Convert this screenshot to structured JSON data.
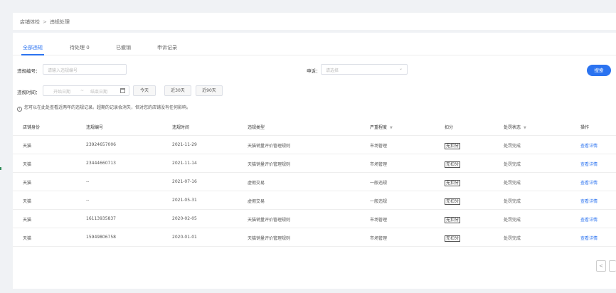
{
  "breadcrumb": {
    "root": "店铺体检",
    "separator": ">",
    "current": "违规处理"
  },
  "tabs": [
    {
      "label": "全部违规",
      "active": true
    },
    {
      "label": "待处理 0",
      "active": false
    },
    {
      "label": "已撤销",
      "active": false
    },
    {
      "label": "申诉记录",
      "active": false
    }
  ],
  "filters": {
    "violation_no_label": "违规编号：",
    "violation_no_placeholder": "请输入违规编号",
    "appeal_label": "申诉：",
    "appeal_placeholder": "请选择",
    "time_label": "违规时间：",
    "start_placeholder": "开始日期",
    "range_separator": "~",
    "end_placeholder": "结束日期",
    "quick_today": "今天",
    "quick_30": "近30天",
    "quick_90": "近90天",
    "search_button": "搜索"
  },
  "notice": "您可以在此处查看近两年的违规记录。超期的记录会消失，但对您的店铺没有任何影响。",
  "table": {
    "headers": [
      "店铺身份",
      "违规编号",
      "违规时间",
      "违规类型",
      "严重程度",
      "扣分",
      "处罚状态",
      "操作"
    ],
    "rows": [
      [
        "天猫",
        "23924657006",
        "2021-11-29",
        "天猫销量评价管理规则",
        "市场管理",
        "无扣分",
        "处罚完成",
        "查看详情"
      ],
      [
        "天猫",
        "23444660713",
        "2021-11-14",
        "天猫销量评价管理规则",
        "市场管理",
        "无扣分",
        "处罚完成",
        "查看详情"
      ],
      [
        "天猫",
        "--",
        "2021-07-16",
        "虚假交易",
        "一般违规",
        "无扣分",
        "处罚完成",
        "查看详情"
      ],
      [
        "天猫",
        "--",
        "2021-05-31",
        "虚假交易",
        "一般违规",
        "无扣分",
        "处罚完成",
        "查看详情"
      ],
      [
        "天猫",
        "16113935837",
        "2020-02-05",
        "天猫销量评价管理规则",
        "市场管理",
        "无扣分",
        "处罚完成",
        "查看详情"
      ],
      [
        "天猫",
        "15949806758",
        "2020-01-01",
        "天猫销量评价管理规则",
        "市场管理",
        "无扣分",
        "处罚完成",
        "查看详情"
      ]
    ]
  },
  "pager": {
    "prev": "<"
  },
  "colors": {
    "accent": "#2b73f0"
  }
}
